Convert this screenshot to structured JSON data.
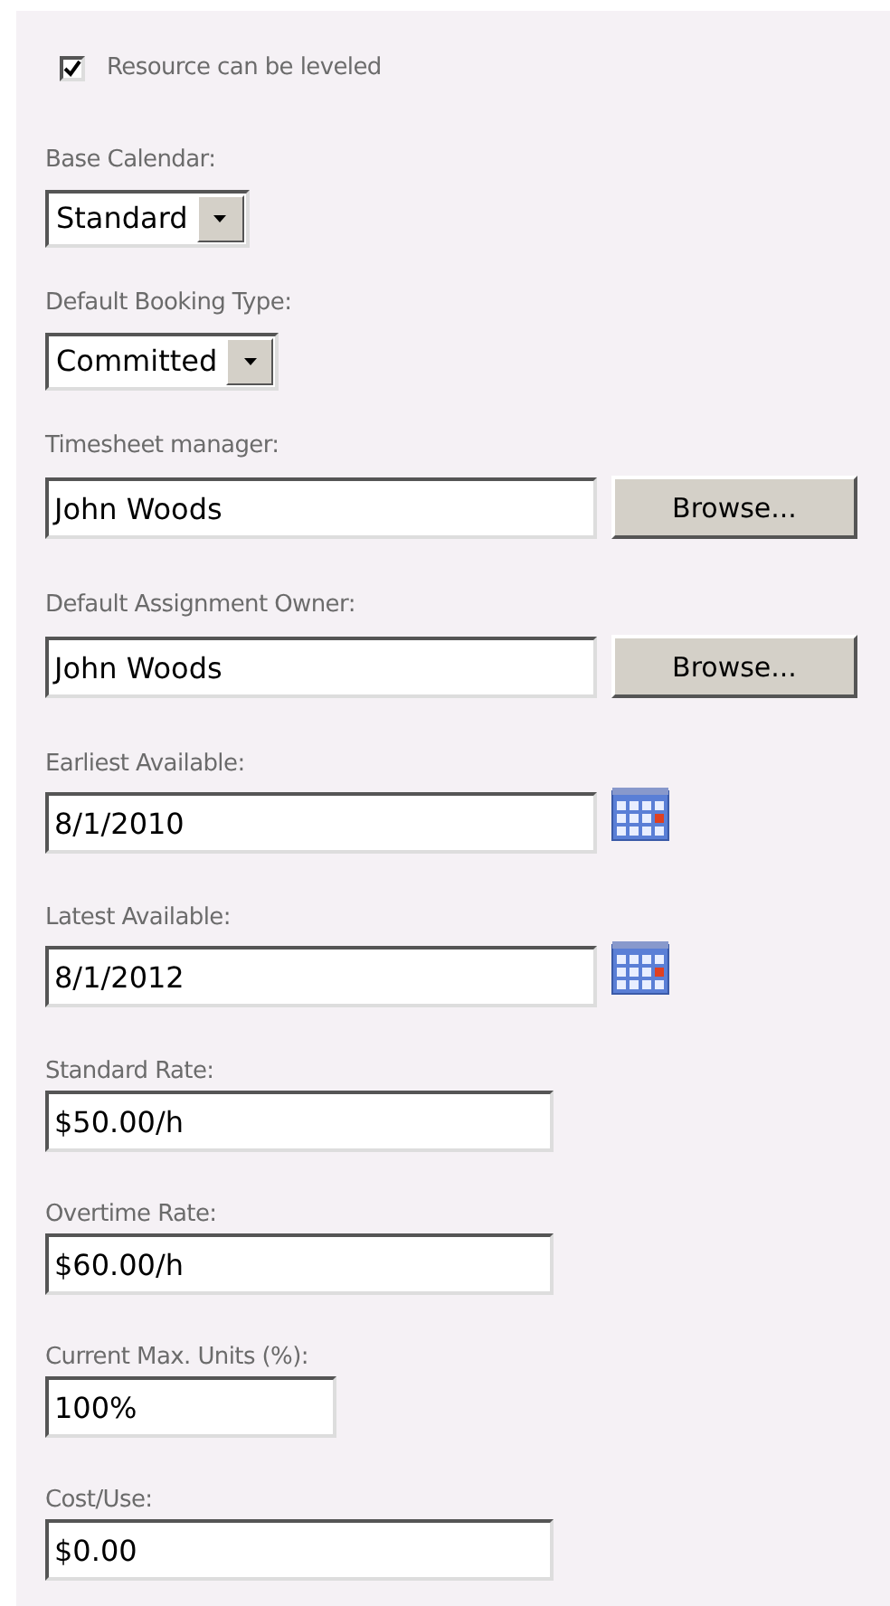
{
  "fields": [
    {
      "kind": "checkbox",
      "label": "Resource can be leveled",
      "checked": true
    },
    {
      "kind": "select",
      "label": "Base Calendar:",
      "value": "Standard"
    },
    {
      "kind": "select",
      "label": "Default Booking Type:",
      "value": "Committed"
    },
    {
      "kind": "lookup",
      "label": "Timesheet manager:",
      "value": "John Woods",
      "button": "Browse..."
    },
    {
      "kind": "lookup",
      "label": "Default Assignment Owner:",
      "value": "John Woods",
      "button": "Browse..."
    },
    {
      "kind": "date",
      "label": "Earliest Available:",
      "value": "8/1/2010"
    },
    {
      "kind": "date",
      "label": "Latest Available:",
      "value": "8/1/2012"
    },
    {
      "kind": "text",
      "label": "Standard Rate:",
      "value": "$50.00/h"
    },
    {
      "kind": "text",
      "label": "Overtime Rate:",
      "value": "$60.00/h"
    },
    {
      "kind": "units",
      "label": "Current Max. Units (%):",
      "value": "100%"
    },
    {
      "kind": "text",
      "label": "Cost/Use:",
      "value": "$0.00"
    }
  ]
}
